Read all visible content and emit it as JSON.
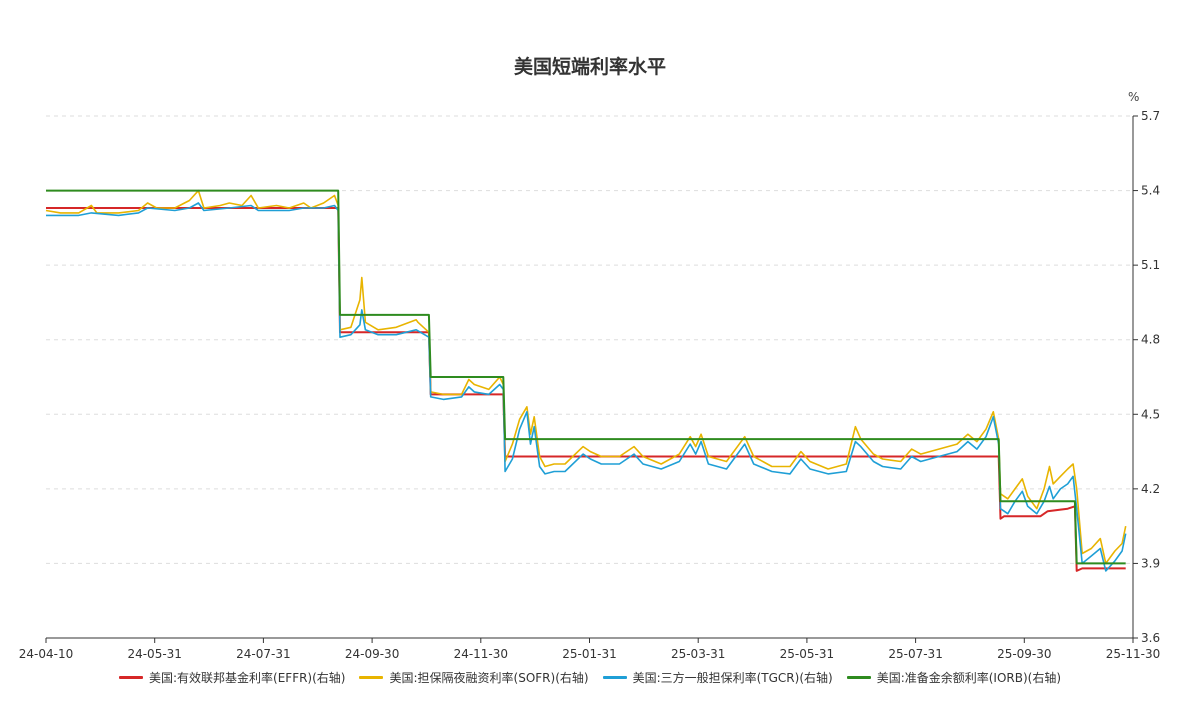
{
  "chart_data": {
    "type": "line",
    "title": "美国短端利率水平",
    "unit": "%",
    "x_tick_labels": [
      "24-04-10",
      "24-05-31",
      "24-07-31",
      "24-09-30",
      "24-11-30",
      "25-01-31",
      "25-03-31",
      "25-05-31",
      "25-07-31",
      "25-09-30",
      "25-11-30"
    ],
    "x_range": [
      "2024-04-10",
      "2025-11-30"
    ],
    "ylim": [
      3.6,
      5.7
    ],
    "y_ticks": [
      3.6,
      3.9,
      4.2,
      4.5,
      4.8,
      5.1,
      5.4,
      5.7
    ],
    "y_axis_side": "right",
    "grid": "horizontal dashed",
    "legend_position": "bottom",
    "series": [
      {
        "name": "美国:有效联邦基金利率(EFFR)(右轴)",
        "color": "#d62728",
        "points": [
          [
            "2024-04-10",
            5.33
          ],
          [
            "2024-09-18",
            5.33
          ],
          [
            "2024-09-19",
            4.83
          ],
          [
            "2024-11-07",
            4.83
          ],
          [
            "2024-11-08",
            4.58
          ],
          [
            "2024-12-18",
            4.58
          ],
          [
            "2024-12-19",
            4.33
          ],
          [
            "2025-09-17",
            4.33
          ],
          [
            "2025-09-18",
            4.08
          ],
          [
            "2025-09-20",
            4.09
          ],
          [
            "2025-10-10",
            4.09
          ],
          [
            "2025-10-14",
            4.11
          ],
          [
            "2025-10-25",
            4.12
          ],
          [
            "2025-10-29",
            4.13
          ],
          [
            "2025-10-30",
            3.87
          ],
          [
            "2025-11-02",
            3.88
          ],
          [
            "2025-11-26",
            3.88
          ]
        ]
      },
      {
        "name": "美国:担保隔夜融资利率(SOFR)(右轴)",
        "color": "#e8b400",
        "points": [
          [
            "2024-04-10",
            5.32
          ],
          [
            "2024-04-18",
            5.31
          ],
          [
            "2024-04-28",
            5.31
          ],
          [
            "2024-05-05",
            5.34
          ],
          [
            "2024-05-08",
            5.31
          ],
          [
            "2024-05-20",
            5.31
          ],
          [
            "2024-05-31",
            5.32
          ],
          [
            "2024-06-05",
            5.35
          ],
          [
            "2024-06-10",
            5.33
          ],
          [
            "2024-06-20",
            5.33
          ],
          [
            "2024-06-28",
            5.36
          ],
          [
            "2024-07-03",
            5.4
          ],
          [
            "2024-07-06",
            5.33
          ],
          [
            "2024-07-15",
            5.34
          ],
          [
            "2024-07-20",
            5.35
          ],
          [
            "2024-07-27",
            5.34
          ],
          [
            "2024-08-01",
            5.38
          ],
          [
            "2024-08-05",
            5.33
          ],
          [
            "2024-08-15",
            5.34
          ],
          [
            "2024-08-22",
            5.33
          ],
          [
            "2024-08-30",
            5.35
          ],
          [
            "2024-09-03",
            5.33
          ],
          [
            "2024-09-10",
            5.35
          ],
          [
            "2024-09-16",
            5.38
          ],
          [
            "2024-09-18",
            5.34
          ],
          [
            "2024-09-19",
            4.84
          ],
          [
            "2024-09-25",
            4.85
          ],
          [
            "2024-09-30",
            4.96
          ],
          [
            "2024-10-01",
            5.05
          ],
          [
            "2024-10-03",
            4.87
          ],
          [
            "2024-10-10",
            4.84
          ],
          [
            "2024-10-20",
            4.85
          ],
          [
            "2024-10-31",
            4.88
          ],
          [
            "2024-11-01",
            4.87
          ],
          [
            "2024-11-07",
            4.83
          ],
          [
            "2024-11-08",
            4.59
          ],
          [
            "2024-11-15",
            4.58
          ],
          [
            "2024-11-25",
            4.58
          ],
          [
            "2024-11-29",
            4.64
          ],
          [
            "2024-12-02",
            4.62
          ],
          [
            "2024-12-10",
            4.6
          ],
          [
            "2024-12-16",
            4.65
          ],
          [
            "2024-12-18",
            4.62
          ],
          [
            "2024-12-19",
            4.31
          ],
          [
            "2024-12-23",
            4.38
          ],
          [
            "2024-12-27",
            4.48
          ],
          [
            "2024-12-31",
            4.53
          ],
          [
            "2025-01-02",
            4.42
          ],
          [
            "2025-01-04",
            4.49
          ],
          [
            "2025-01-07",
            4.33
          ],
          [
            "2025-01-10",
            4.29
          ],
          [
            "2025-01-15",
            4.3
          ],
          [
            "2025-01-21",
            4.3
          ],
          [
            "2025-01-31",
            4.37
          ],
          [
            "2025-02-04",
            4.35
          ],
          [
            "2025-02-10",
            4.33
          ],
          [
            "2025-02-20",
            4.33
          ],
          [
            "2025-02-28",
            4.37
          ],
          [
            "2025-03-05",
            4.33
          ],
          [
            "2025-03-15",
            4.3
          ],
          [
            "2025-03-25",
            4.34
          ],
          [
            "2025-03-31",
            4.41
          ],
          [
            "2025-04-03",
            4.37
          ],
          [
            "2025-04-06",
            4.42
          ],
          [
            "2025-04-10",
            4.33
          ],
          [
            "2025-04-20",
            4.31
          ],
          [
            "2025-04-30",
            4.41
          ],
          [
            "2025-05-05",
            4.33
          ],
          [
            "2025-05-15",
            4.29
          ],
          [
            "2025-05-25",
            4.29
          ],
          [
            "2025-05-31",
            4.35
          ],
          [
            "2025-06-05",
            4.31
          ],
          [
            "2025-06-15",
            4.28
          ],
          [
            "2025-06-25",
            4.3
          ],
          [
            "2025-06-30",
            4.45
          ],
          [
            "2025-07-03",
            4.4
          ],
          [
            "2025-07-10",
            4.34
          ],
          [
            "2025-07-15",
            4.32
          ],
          [
            "2025-07-25",
            4.31
          ],
          [
            "2025-07-31",
            4.36
          ],
          [
            "2025-08-05",
            4.34
          ],
          [
            "2025-08-15",
            4.36
          ],
          [
            "2025-08-25",
            4.38
          ],
          [
            "2025-08-31",
            4.42
          ],
          [
            "2025-09-05",
            4.39
          ],
          [
            "2025-09-10",
            4.44
          ],
          [
            "2025-09-14",
            4.51
          ],
          [
            "2025-09-17",
            4.4
          ],
          [
            "2025-09-18",
            4.18
          ],
          [
            "2025-09-22",
            4.16
          ],
          [
            "2025-09-26",
            4.2
          ],
          [
            "2025-09-30",
            4.24
          ],
          [
            "2025-10-03",
            4.17
          ],
          [
            "2025-10-08",
            4.12
          ],
          [
            "2025-10-12",
            4.2
          ],
          [
            "2025-10-15",
            4.29
          ],
          [
            "2025-10-17",
            4.22
          ],
          [
            "2025-10-21",
            4.25
          ],
          [
            "2025-10-25",
            4.28
          ],
          [
            "2025-10-28",
            4.3
          ],
          [
            "2025-10-30",
            4.2
          ],
          [
            "2025-11-02",
            3.94
          ],
          [
            "2025-11-07",
            3.96
          ],
          [
            "2025-11-12",
            4.0
          ],
          [
            "2025-11-15",
            3.9
          ],
          [
            "2025-11-20",
            3.95
          ],
          [
            "2025-11-24",
            3.98
          ],
          [
            "2025-11-26",
            4.05
          ]
        ]
      },
      {
        "name": "美国:三方一般担保利率(TGCR)(右轴)",
        "color": "#1f9fd6",
        "points": [
          [
            "2024-04-10",
            5.3
          ],
          [
            "2024-04-18",
            5.3
          ],
          [
            "2024-04-28",
            5.3
          ],
          [
            "2024-05-05",
            5.31
          ],
          [
            "2024-05-20",
            5.3
          ],
          [
            "2024-05-31",
            5.31
          ],
          [
            "2024-06-05",
            5.33
          ],
          [
            "2024-06-20",
            5.32
          ],
          [
            "2024-06-28",
            5.33
          ],
          [
            "2024-07-03",
            5.35
          ],
          [
            "2024-07-06",
            5.32
          ],
          [
            "2024-07-20",
            5.33
          ],
          [
            "2024-08-01",
            5.34
          ],
          [
            "2024-08-05",
            5.32
          ],
          [
            "2024-08-22",
            5.32
          ],
          [
            "2024-08-30",
            5.33
          ],
          [
            "2024-09-10",
            5.33
          ],
          [
            "2024-09-16",
            5.34
          ],
          [
            "2024-09-18",
            5.32
          ],
          [
            "2024-09-19",
            4.81
          ],
          [
            "2024-09-25",
            4.82
          ],
          [
            "2024-09-30",
            4.86
          ],
          [
            "2024-10-01",
            4.92
          ],
          [
            "2024-10-03",
            4.84
          ],
          [
            "2024-10-10",
            4.82
          ],
          [
            "2024-10-20",
            4.82
          ],
          [
            "2024-10-31",
            4.84
          ],
          [
            "2024-11-07",
            4.81
          ],
          [
            "2024-11-08",
            4.57
          ],
          [
            "2024-11-15",
            4.56
          ],
          [
            "2024-11-25",
            4.57
          ],
          [
            "2024-11-29",
            4.61
          ],
          [
            "2024-12-02",
            4.59
          ],
          [
            "2024-12-10",
            4.58
          ],
          [
            "2024-12-16",
            4.62
          ],
          [
            "2024-12-18",
            4.6
          ],
          [
            "2024-12-19",
            4.27
          ],
          [
            "2024-12-23",
            4.32
          ],
          [
            "2024-12-27",
            4.44
          ],
          [
            "2024-12-31",
            4.51
          ],
          [
            "2025-01-02",
            4.38
          ],
          [
            "2025-01-04",
            4.45
          ],
          [
            "2025-01-07",
            4.29
          ],
          [
            "2025-01-10",
            4.26
          ],
          [
            "2025-01-15",
            4.27
          ],
          [
            "2025-01-21",
            4.27
          ],
          [
            "2025-01-31",
            4.34
          ],
          [
            "2025-02-04",
            4.32
          ],
          [
            "2025-02-10",
            4.3
          ],
          [
            "2025-02-20",
            4.3
          ],
          [
            "2025-02-28",
            4.34
          ],
          [
            "2025-03-05",
            4.3
          ],
          [
            "2025-03-15",
            4.28
          ],
          [
            "2025-03-25",
            4.31
          ],
          [
            "2025-03-31",
            4.38
          ],
          [
            "2025-04-03",
            4.34
          ],
          [
            "2025-04-06",
            4.39
          ],
          [
            "2025-04-10",
            4.3
          ],
          [
            "2025-04-20",
            4.28
          ],
          [
            "2025-04-30",
            4.38
          ],
          [
            "2025-05-05",
            4.3
          ],
          [
            "2025-05-15",
            4.27
          ],
          [
            "2025-05-25",
            4.26
          ],
          [
            "2025-05-31",
            4.32
          ],
          [
            "2025-06-05",
            4.28
          ],
          [
            "2025-06-15",
            4.26
          ],
          [
            "2025-06-25",
            4.27
          ],
          [
            "2025-06-30",
            4.39
          ],
          [
            "2025-07-03",
            4.37
          ],
          [
            "2025-07-10",
            4.31
          ],
          [
            "2025-07-15",
            4.29
          ],
          [
            "2025-07-25",
            4.28
          ],
          [
            "2025-07-31",
            4.33
          ],
          [
            "2025-08-05",
            4.31
          ],
          [
            "2025-08-15",
            4.33
          ],
          [
            "2025-08-25",
            4.35
          ],
          [
            "2025-08-31",
            4.39
          ],
          [
            "2025-09-05",
            4.36
          ],
          [
            "2025-09-10",
            4.41
          ],
          [
            "2025-09-14",
            4.49
          ],
          [
            "2025-09-17",
            4.38
          ],
          [
            "2025-09-18",
            4.12
          ],
          [
            "2025-09-22",
            4.1
          ],
          [
            "2025-09-26",
            4.15
          ],
          [
            "2025-09-30",
            4.19
          ],
          [
            "2025-10-03",
            4.13
          ],
          [
            "2025-10-08",
            4.1
          ],
          [
            "2025-10-12",
            4.15
          ],
          [
            "2025-10-15",
            4.21
          ],
          [
            "2025-10-17",
            4.16
          ],
          [
            "2025-10-21",
            4.2
          ],
          [
            "2025-10-25",
            4.22
          ],
          [
            "2025-10-28",
            4.25
          ],
          [
            "2025-10-30",
            4.12
          ],
          [
            "2025-11-02",
            3.9
          ],
          [
            "2025-11-07",
            3.93
          ],
          [
            "2025-11-12",
            3.96
          ],
          [
            "2025-11-15",
            3.87
          ],
          [
            "2025-11-20",
            3.91
          ],
          [
            "2025-11-24",
            3.95
          ],
          [
            "2025-11-26",
            4.02
          ]
        ]
      },
      {
        "name": "美国:准备金余额利率(IORB)(右轴)",
        "color": "#2e8b1f",
        "points": [
          [
            "2024-04-10",
            5.4
          ],
          [
            "2024-09-18",
            5.4
          ],
          [
            "2024-09-19",
            4.9
          ],
          [
            "2024-11-07",
            4.9
          ],
          [
            "2024-11-08",
            4.65
          ],
          [
            "2024-12-18",
            4.65
          ],
          [
            "2024-12-19",
            4.4
          ],
          [
            "2025-09-17",
            4.4
          ],
          [
            "2025-09-18",
            4.15
          ],
          [
            "2025-10-29",
            4.15
          ],
          [
            "2025-10-30",
            3.9
          ],
          [
            "2025-11-26",
            3.9
          ]
        ]
      }
    ]
  }
}
